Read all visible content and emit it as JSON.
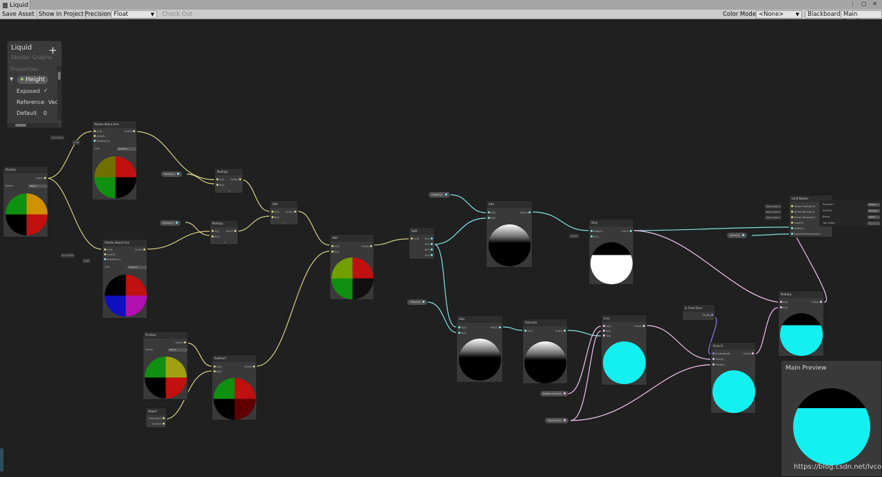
{
  "window": {
    "tab_title": "Liquid",
    "controls": "⋮ □ ✕"
  },
  "toolbar": {
    "save_asset": "Save Asset",
    "show_in_project": "Show In Project",
    "precision_label": "Precision",
    "precision_value": "Float",
    "check_out": "Check Out",
    "color_mode_label": "Color Mode",
    "color_mode_value": "<None>",
    "blackboard": "Blackboard",
    "main_preview": "Main Preview"
  },
  "blackboard": {
    "title": "Liquid",
    "subtitle": "Shader Graphs",
    "add": "+",
    "properties_label": "Properties",
    "property_name": "Height",
    "exposed_label": "Exposed",
    "exposed_check": "✓",
    "reference_label": "Reference",
    "reference_value": "Vec",
    "default_label": "Default",
    "default_value": "0"
  },
  "nodes": {
    "position1": {
      "title": "Position",
      "out": "Out(3)",
      "space_label": "Space",
      "space_value": "Object"
    },
    "rotate1": {
      "title": "Rotate About Axis",
      "in": "In(3)",
      "axis": "Axis(3)",
      "rotation": "Rotation(1)",
      "out": "Out(3)",
      "unit_label": "Unit",
      "unit_value": "Degrees"
    },
    "rotate2": {
      "title": "Rotate About Axis",
      "in": "In(3)",
      "axis": "Axis(3)",
      "rotation": "Rotation(1)",
      "out": "Out(3)",
      "unit_label": "Unit",
      "unit_value": "Degrees"
    },
    "multiply1": {
      "title": "Multiply",
      "a": "A(1)",
      "b": "B(1)",
      "out": "Out(1)"
    },
    "multiply2": {
      "title": "Multiply",
      "a": "A(1)",
      "b": "B(1)",
      "out": "Out(1)"
    },
    "add1": {
      "title": "Add",
      "a": "A(1)",
      "b": "B(1)",
      "out": "Out(1)"
    },
    "add2": {
      "title": "Add",
      "a": "A(3)",
      "b": "B(3)",
      "out": "Out(3)"
    },
    "position2": {
      "title": "Position",
      "out": "Out(3)",
      "space_label": "Space",
      "space_value": "World"
    },
    "subtract": {
      "title": "Subtract",
      "a": "A(3)",
      "b": "B(3)",
      "out": "Out(3)"
    },
    "object": {
      "title": "Object",
      "pos": "Position(3)",
      "scale": "Scale(3)"
    },
    "split": {
      "title": "Split",
      "in": "In(4)",
      "r": "R(1)",
      "g": "G(1)",
      "b": "B(1)",
      "a": "A(1)"
    },
    "add3": {
      "title": "Add",
      "a": "A(1)",
      "b": "B(1)",
      "out": "Out(1)"
    },
    "add4": {
      "title": "Add",
      "a": "A(1)",
      "b": "B(1)",
      "out": "Out(1)"
    },
    "step": {
      "title": "Step",
      "edge": "Edge(1)",
      "in": "In(1)",
      "out": "Out(1)"
    },
    "saturate": {
      "title": "Saturate",
      "in": "In(1)",
      "out": "Out(1)"
    },
    "lerp": {
      "title": "Lerp",
      "a": "A(4)",
      "b": "B(4)",
      "t": "T(4)",
      "out": "Out(4)"
    },
    "isfront": {
      "title": "Is Front Face",
      "out": "Out(B)"
    },
    "branch": {
      "title": "Branch",
      "pred": "Predicate(B)",
      "true": "True(4)",
      "false": "False(4)",
      "out": "Out(4)"
    },
    "multiply3": {
      "title": "Multiply",
      "a": "A(4)",
      "b": "B(4)",
      "out": "Out(4)"
    },
    "master": {
      "title": "Unlit Master",
      "ports": [
        "Vertex Position(3)",
        "Vertex Normal(3)",
        "Vertex Tangent(3)",
        "Color(3)",
        "Alpha(1)",
        "AlphaClipThreshold(1)"
      ],
      "space_tags": [
        "Object Space",
        "Object Space",
        "Object Space"
      ],
      "settings": [
        {
          "label": "Precision",
          "value": "Inherit"
        },
        {
          "label": "Surface",
          "value": "Opaque"
        },
        {
          "label": "Blend",
          "value": "Alpha"
        },
        {
          "label": "Two Sided",
          "value": "✓"
        }
      ]
    }
  },
  "pills": {
    "speed": "Speed(1)",
    "speed2": "Speed(1)",
    "height": "Height(1)",
    "offset": "Offset(1)",
    "alpha": "Alpha(1)",
    "bottomcolor": "BottomColor(4)",
    "topcolor": "TopColor(4)"
  },
  "vectors": {
    "axis1": "X 0   Y 0   Z 1",
    "rot1": "X 90",
    "axis2": "X 1   Y 0   Z 0",
    "rot2": "X 90",
    "step_edge": "X 0.21"
  },
  "main_preview": {
    "title": "Main Preview"
  },
  "watermark": "https://blog.csdn.net/lvcoc",
  "colors": {
    "wire_vec3": "#d6d08a",
    "wire_float": "#84e4e7",
    "wire_vec4": "#f0c6f0",
    "wire_bool": "#9481e6",
    "accent_cyan": "#14f0f0"
  }
}
